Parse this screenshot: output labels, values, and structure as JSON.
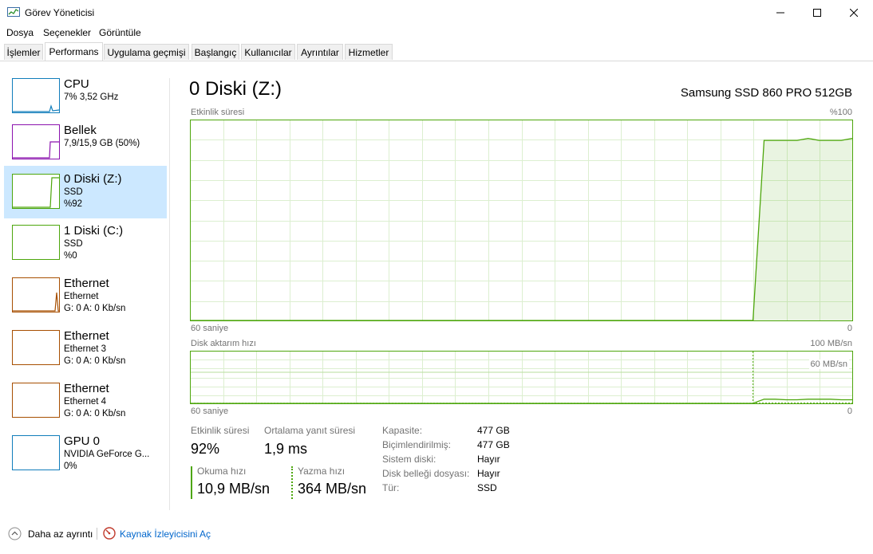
{
  "window": {
    "title": "Görev Yöneticisi"
  },
  "menu": [
    "Dosya",
    "Seçenekler",
    "Görüntüle"
  ],
  "tabs": [
    "İşlemler",
    "Performans",
    "Uygulama geçmişi",
    "Başlangıç",
    "Kullanıcılar",
    "Ayrıntılar",
    "Hizmetler"
  ],
  "active_tab": "Performans",
  "sidebar": {
    "items": [
      {
        "title": "CPU",
        "line1": "7%  3,52 GHz",
        "line2": "",
        "line3": "",
        "color": "#117dbb"
      },
      {
        "title": "Bellek",
        "line1": "7,9/15,9 GB (50%)",
        "line2": "",
        "line3": "",
        "color": "#8b12ae"
      },
      {
        "title": "0 Diski (Z:)",
        "line1": "SSD",
        "line2": "%92",
        "line3": "",
        "color": "#4da60c",
        "selected": true
      },
      {
        "title": "1 Diski (C:)",
        "line1": "SSD",
        "line2": "%0",
        "line3": "",
        "color": "#4da60c"
      },
      {
        "title": "Ethernet",
        "line1": "Ethernet",
        "line2": "G: 0  A: 0 Kb/sn",
        "line3": "",
        "color": "#a74f01"
      },
      {
        "title": "Ethernet",
        "line1": "Ethernet 3",
        "line2": "G: 0  A: 0 Kb/sn",
        "line3": "",
        "color": "#a74f01"
      },
      {
        "title": "Ethernet",
        "line1": "Ethernet 4",
        "line2": "G: 0  A: 0 Kb/sn",
        "line3": "",
        "color": "#a74f01"
      },
      {
        "title": "GPU 0",
        "line1": "NVIDIA GeForce G...",
        "line2": "0%",
        "line3": "",
        "color": "#117dbb"
      }
    ]
  },
  "main": {
    "title": "0 Diski (Z:)",
    "device": "Samsung SSD 860 PRO 512GB",
    "graph1": {
      "label": "Etkinlik süresi",
      "max_label": "%100",
      "left_label": "60 saniye",
      "right_label": "0"
    },
    "graph2": {
      "label": "Disk aktarım hızı",
      "max_label": "100 MB/sn",
      "mid_label": "60 MB/sn",
      "left_label": "60 saniye",
      "right_label": "0"
    },
    "stats": {
      "active_time_label": "Etkinlik süresi",
      "active_time_value": "92%",
      "avg_response_label": "Ortalama yanıt süresi",
      "avg_response_value": "1,9 ms",
      "read_label": "Okuma hızı",
      "read_value": "10,9 MB/sn",
      "write_label": "Yazma hızı",
      "write_value": "364 MB/sn"
    },
    "properties": [
      {
        "label": "Kapasite:",
        "value": "477 GB"
      },
      {
        "label": "Biçimlendirilmiş:",
        "value": "477 GB"
      },
      {
        "label": "Sistem diski:",
        "value": "Hayır"
      },
      {
        "label": "Disk belleği dosyası:",
        "value": "Hayır"
      },
      {
        "label": "Tür:",
        "value": "SSD"
      }
    ]
  },
  "footer": {
    "fewer_details": "Daha az ayrıntı",
    "resource_monitor": "Kaynak İzleyicisini Aç"
  },
  "chart_data": [
    {
      "type": "area",
      "title": "Etkinlik süresi",
      "xlabel": "60 saniye",
      "ylim": [
        0,
        100
      ],
      "x": [
        60,
        54,
        48,
        42,
        36,
        30,
        24,
        18,
        12,
        9,
        8,
        7,
        6,
        5,
        4,
        3,
        2,
        1,
        0
      ],
      "series": [
        {
          "values": [
            0,
            0,
            0,
            0,
            0,
            0,
            0,
            0,
            0,
            0,
            90,
            90,
            90,
            90,
            91,
            90,
            90,
            90,
            91
          ]
        }
      ],
      "grid": true
    },
    {
      "type": "line",
      "title": "Disk aktarım hızı",
      "xlabel": "60 saniye",
      "ylim": [
        0,
        100
      ],
      "x": [
        60,
        54,
        48,
        42,
        36,
        30,
        24,
        18,
        12,
        9,
        8,
        7,
        6,
        5,
        4,
        3,
        2,
        1,
        0
      ],
      "series": [
        {
          "values": [
            0,
            0,
            0,
            0,
            0,
            0,
            0,
            0,
            0,
            0,
            8,
            8,
            7,
            7,
            8,
            8,
            8,
            7,
            7
          ]
        },
        {
          "values": [
            0,
            0,
            0,
            0,
            0,
            0,
            0,
            0,
            0,
            0,
            0.3,
            0.3,
            0.3,
            0.3,
            0.3,
            0.3,
            0.3,
            0.3,
            0.3
          ]
        }
      ],
      "grid": true
    }
  ]
}
